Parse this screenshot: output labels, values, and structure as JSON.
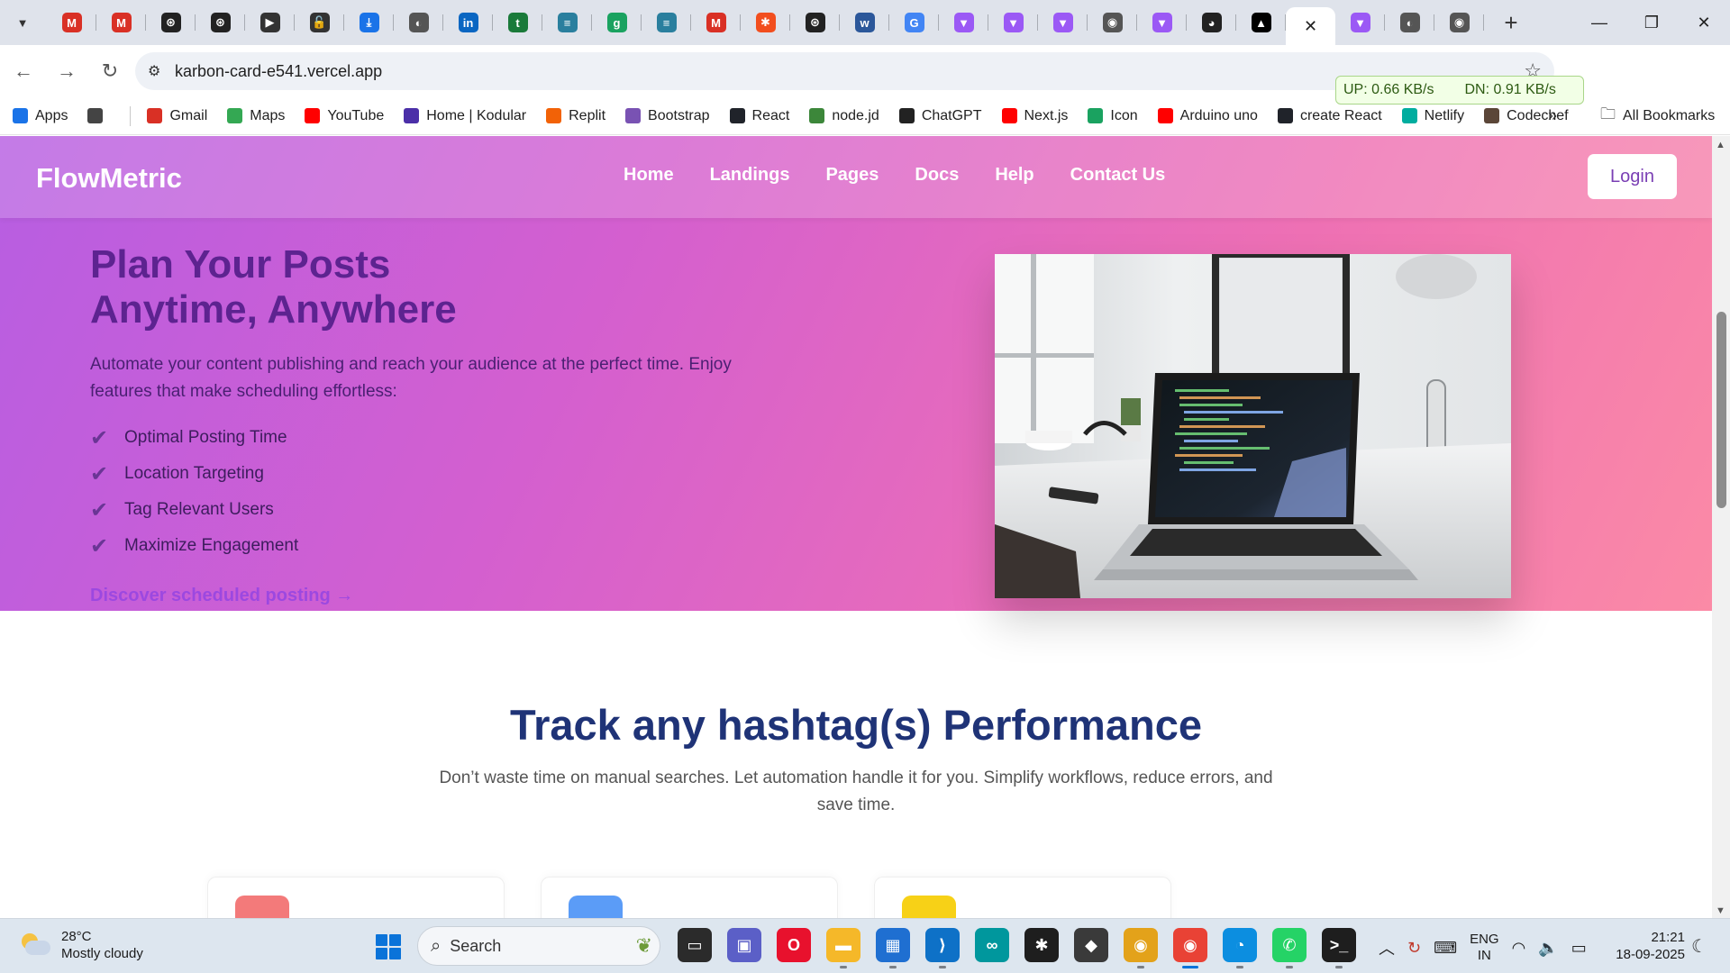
{
  "browser": {
    "tabs": [
      {
        "icon": "gmail-icon",
        "color": "#d93025",
        "glyph": "M"
      },
      {
        "icon": "gmail-icon",
        "color": "#d93025",
        "glyph": "M"
      },
      {
        "icon": "openai-icon",
        "color": "#222222",
        "glyph": "⊛"
      },
      {
        "icon": "openai-icon",
        "color": "#222222",
        "glyph": "⊛"
      },
      {
        "icon": "bookmark-app-icon",
        "color": "#333333",
        "glyph": "▶"
      },
      {
        "icon": "lock-icon",
        "color": "#333333",
        "glyph": "🔓"
      },
      {
        "icon": "download-icon",
        "color": "#1a73e8",
        "glyph": "⤓"
      },
      {
        "icon": "globe-icon",
        "color": "#555555",
        "glyph": "◐"
      },
      {
        "icon": "linkedin-icon",
        "color": "#0a66c2",
        "glyph": "in"
      },
      {
        "icon": "tutorial-icon",
        "color": "#1a7a3a",
        "glyph": "t"
      },
      {
        "icon": "stack-icon",
        "color": "#2a7f9e",
        "glyph": "≡"
      },
      {
        "icon": "g-icon",
        "color": "#1aa260",
        "glyph": "g"
      },
      {
        "icon": "stack-icon",
        "color": "#2a7f9e",
        "glyph": "≡"
      },
      {
        "icon": "gmail-icon",
        "color": "#d93025",
        "glyph": "M"
      },
      {
        "icon": "figma-icon",
        "color": "#f24e1e",
        "glyph": "✱"
      },
      {
        "icon": "openai-icon",
        "color": "#222222",
        "glyph": "⊛"
      },
      {
        "icon": "word-icon",
        "color": "#2b579a",
        "glyph": "w"
      },
      {
        "icon": "google-icon",
        "color": "#4285f4",
        "glyph": "G"
      },
      {
        "icon": "vite-icon",
        "color": "#9b59f5",
        "glyph": "▼"
      },
      {
        "icon": "vite-icon",
        "color": "#9b59f5",
        "glyph": "▼"
      },
      {
        "icon": "vite-icon",
        "color": "#9b59f5",
        "glyph": "▼"
      },
      {
        "icon": "chrome-icon",
        "color": "#555555",
        "glyph": "◉"
      },
      {
        "icon": "vite-icon",
        "color": "#9b59f5",
        "glyph": "▼"
      },
      {
        "icon": "github-icon",
        "color": "#222222",
        "glyph": "◕"
      },
      {
        "icon": "vercel-icon",
        "color": "#000000",
        "glyph": "▲"
      },
      {
        "icon": "close-icon",
        "color": "#222222",
        "glyph": "✕",
        "active": true
      },
      {
        "icon": "vite-icon",
        "color": "#9b59f5",
        "glyph": "▼"
      },
      {
        "icon": "globe-icon",
        "color": "#555555",
        "glyph": "◐"
      },
      {
        "icon": "chrome-icon",
        "color": "#555555",
        "glyph": "◉"
      }
    ],
    "url": "karbon-card-e541.vercel.app",
    "speed_up": "UP: 0.66 KB/s",
    "speed_down": "DN: 0.91 KB/s",
    "bookmarks": [
      {
        "label": "Apps",
        "icon": "apps-grid-icon",
        "color": "#1a73e8"
      },
      {
        "label": "",
        "icon": "grid-icon",
        "color": "#444444"
      },
      {
        "label": "Gmail",
        "icon": "gmail-icon",
        "color": "#d93025"
      },
      {
        "label": "Maps",
        "icon": "maps-pin-icon",
        "color": "#34a853"
      },
      {
        "label": "YouTube",
        "icon": "youtube-icon",
        "color": "#ff0000"
      },
      {
        "label": "Home | Kodular",
        "icon": "kodular-icon",
        "color": "#4b2fa8"
      },
      {
        "label": "Replit",
        "icon": "replit-icon",
        "color": "#f26207"
      },
      {
        "label": "Bootstrap",
        "icon": "bootstrap-icon",
        "color": "#7952b3"
      },
      {
        "label": "React",
        "icon": "react-icon",
        "color": "#20232a"
      },
      {
        "label": "node.jd",
        "icon": "nodejs-icon",
        "color": "#3c873a"
      },
      {
        "label": "ChatGPT",
        "icon": "openai-icon",
        "color": "#222222"
      },
      {
        "label": "Next.js",
        "icon": "youtube-icon",
        "color": "#ff0000"
      },
      {
        "label": "Icon",
        "icon": "icon-site-icon",
        "color": "#1aa260"
      },
      {
        "label": "Arduino uno",
        "icon": "youtube-icon",
        "color": "#ff0000"
      },
      {
        "label": "create React",
        "icon": "react-icon",
        "color": "#20232a"
      },
      {
        "label": "Netlify",
        "icon": "netlify-icon",
        "color": "#00ad9f"
      },
      {
        "label": "Codechef",
        "icon": "codechef-icon",
        "color": "#5b4638"
      }
    ],
    "all_bookmarks": "All Bookmarks"
  },
  "site": {
    "brand": "FlowMetric",
    "nav": [
      "Home",
      "Landings",
      "Pages",
      "Docs",
      "Help",
      "Contact Us"
    ],
    "login": "Login",
    "hero": {
      "title": "Plan Your Posts Anytime, Anywhere",
      "description": "Automate your content publishing and reach your audience at the perfect time. Enjoy features that make scheduling effortless:",
      "features": [
        "Optimal Posting Time",
        "Location Targeting",
        "Tag Relevant Users",
        "Maximize Engagement"
      ],
      "cta": "Discover scheduled posting →",
      "image_alt": "laptop-on-desk-image"
    },
    "section": {
      "title": "Track any hashtag(s) Performance",
      "subtitle": "Don’t waste time on manual searches. Let automation handle it for you. Simplify workflows, reduce errors, and save time."
    },
    "card_colors": [
      "#f37a7a",
      "#5b9cf7",
      "#f7d117"
    ]
  },
  "taskbar": {
    "temperature": "28°C",
    "condition": "Mostly cloudy",
    "search_placeholder": "Search",
    "apps": [
      {
        "icon": "file-explorer-black-icon",
        "color": "#2b2b2b",
        "glyph": "▭"
      },
      {
        "icon": "video-call-icon",
        "color": "#5b5fc7",
        "glyph": "▣"
      },
      {
        "icon": "opera-icon",
        "color": "#e8112d",
        "glyph": "O"
      },
      {
        "icon": "folder-icon",
        "color": "#f5b829",
        "glyph": "▬",
        "running": true
      },
      {
        "icon": "store-icon",
        "color": "#1f6fd1",
        "glyph": "▦",
        "running": true
      },
      {
        "icon": "vscode-icon",
        "color": "#0e71c7",
        "glyph": "⟩",
        "running": true
      },
      {
        "icon": "arduino-icon",
        "color": "#00979d",
        "glyph": "∞"
      },
      {
        "icon": "figma-icon",
        "color": "#1e1e1e",
        "glyph": "✱"
      },
      {
        "icon": "sticker-app-icon",
        "color": "#3a3a3a",
        "glyph": "◆"
      },
      {
        "icon": "chrome-canary-icon",
        "color": "#e3a21a",
        "glyph": "◉",
        "running": true
      },
      {
        "icon": "chrome-icon",
        "color": "#e94235",
        "glyph": "◉",
        "running": true,
        "active": true
      },
      {
        "icon": "edge-icon",
        "color": "#0c8ee0",
        "glyph": "◔",
        "running": true
      },
      {
        "icon": "whatsapp-icon",
        "color": "#25d366",
        "glyph": "✆",
        "running": true
      },
      {
        "icon": "terminal-icon",
        "color": "#1e1e1e",
        "glyph": ">_",
        "running": true
      }
    ],
    "lang_top": "ENG",
    "lang_bottom": "IN",
    "time": "21:21",
    "date": "18-09-2025"
  }
}
